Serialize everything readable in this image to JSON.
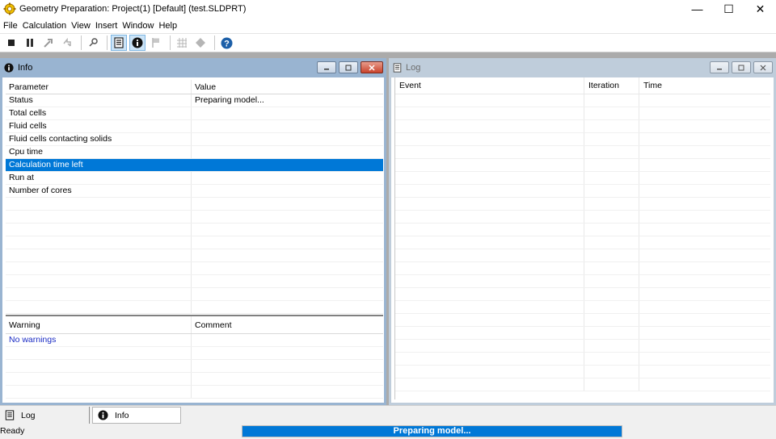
{
  "window": {
    "title": "Geometry Preparation: Project(1) [Default] (test.SLDPRT)",
    "controls": {
      "minimize": "—",
      "maximize": "☐",
      "close": "✕"
    }
  },
  "menu": {
    "items": [
      "File",
      "Calculation",
      "View",
      "Insert",
      "Window",
      "Help"
    ]
  },
  "toolbar": {
    "buttons": [
      "stop-icon",
      "pause-icon",
      "insert-goal-icon",
      "refresh-icon",
      "probe-icon",
      "log-icon",
      "info-icon",
      "flag-icon",
      "grid-icon",
      "goals-plot-icon",
      "help-icon"
    ]
  },
  "info_panel": {
    "title": "Info",
    "params": {
      "headers": [
        "Parameter",
        "Value"
      ],
      "rows": [
        [
          "Status",
          "Preparing model..."
        ],
        [
          "Total cells",
          ""
        ],
        [
          "Fluid cells",
          ""
        ],
        [
          "Fluid cells contacting solids",
          ""
        ],
        [
          "Cpu time",
          ""
        ],
        [
          "Calculation time left",
          ""
        ],
        [
          "Run at",
          ""
        ],
        [
          "Number of cores",
          ""
        ]
      ],
      "selected_row": "Calculation time left"
    },
    "warnings": {
      "headers": [
        "Warning",
        "Comment"
      ],
      "rows": [
        [
          "No warnings",
          ""
        ]
      ]
    }
  },
  "log_panel": {
    "title": "Log",
    "headers": [
      "Event",
      "Iteration",
      "Time"
    ]
  },
  "tabs": [
    {
      "label": "Log",
      "active": false
    },
    {
      "label": "Info",
      "active": true
    }
  ],
  "status": {
    "text": "Ready",
    "progress_label": "Preparing model...",
    "progress_fraction": 1.0
  },
  "colors": {
    "selection": "#0078d7",
    "progress": "#0078d7",
    "warning_text": "#1a2bc4"
  }
}
